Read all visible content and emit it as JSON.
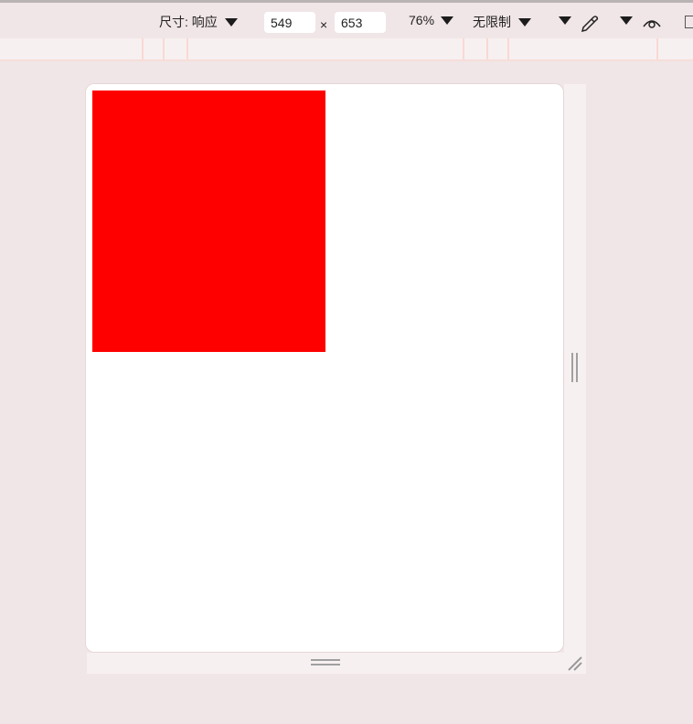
{
  "toolbar": {
    "dimensions_label": "尺寸: 响应",
    "width_value": "549",
    "times": "×",
    "height_value": "653",
    "zoom": "76%",
    "throttle": "无限制",
    "icons": [
      "chevron-down-icon",
      "eyedropper-icon",
      "eye-icon"
    ]
  },
  "colors": {
    "content_box": "#ff0000",
    "background": "#f1e6e7"
  }
}
